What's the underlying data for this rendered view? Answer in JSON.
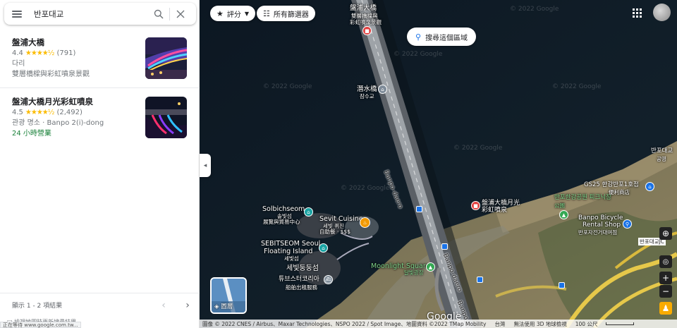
{
  "search": {
    "query": "반포대교"
  },
  "results": [
    {
      "title": "盤浦大橋",
      "rating": "4.4",
      "stars": "★★★★½",
      "reviews": "(791)",
      "line1": "다리",
      "line2": "雙層橋樑與彩虹噴泉景觀",
      "open": ""
    },
    {
      "title": "盤浦大橋月光彩虹噴泉",
      "rating": "4.5",
      "stars": "★★★★½",
      "reviews": "(2,492)",
      "line1": "관광 명소 · Banpo 2(i)-dong",
      "line2": "",
      "open": "24 小時營業"
    }
  ],
  "pager": {
    "text": "顯示 1 - 2 項結果"
  },
  "footer": {
    "text": "□ 檢視地圖時更新搜尋結果"
  },
  "status_url": "正在等待 www.google.com.tw...",
  "map": {
    "chips": {
      "rating": "評分",
      "filters": "所有篩選器"
    },
    "search_area": "搜尋這個區域",
    "layers_label": "圖層",
    "labels": {
      "bridge": "盤浦大橋",
      "bridge_sub": "雙層橋樑與",
      "bridge_sub2": "彩虹噴泉景觀",
      "jamsu": "潛水橋",
      "jamsu_kr": "잠수교",
      "banpo_daero_1": "Banpo-daero",
      "banpo_daero_2": "Banpo-daero",
      "banpo_daero_3": "Banpo-daero",
      "solbitseom": "Solbichseom",
      "solbitseom_kr": "솔빛섬",
      "solbitseom_sub": "展覽與貿易中心",
      "sevit_cuisine": "Sevit Cuisine",
      "sevit_cuisine_kr": "세빛 퀴진",
      "sevit_cuisine_sub": "自助餐 · $$$",
      "sebitseom": "SEBITSEOM Seoul",
      "floating": "Floating Island",
      "sebitseom_kr": "세빛섬",
      "sevit_dongdong": "세빛둥둥섬",
      "tube": "튜브스터코리아",
      "tube_sub": "船舶出租服務",
      "moonlight": "Moonlight Square",
      "moonlight_kr": "달빛광장",
      "fountain": "盤浦大橋月光",
      "fountain2": "彩虹噴泉",
      "banpo_park": "반포한강공원 피크닉장",
      "banpo_park2": "公園",
      "gs25": "GS25 한강반포1호점",
      "gs25_sub": "便利商店",
      "bicycle": "Banpo Bicycle",
      "bicycle2": "Rental Shop",
      "bicycle_kr": "반포자전거대여점",
      "banpo_jc": "반포대교JC",
      "banpo_edge": "반포대교",
      "banpo_edge2": "공영"
    },
    "watermark": "© 2022 Google",
    "google": "Google",
    "attribution": "圖像 © 2022 CNES / Airbus、Maxar Technologies、NSPO 2022 / Spot Image、地圖資料 ©2022 TMap Mobility",
    "country": "台灣",
    "no3d": "無法使用 3D 地球檢視",
    "scale": "100 公尺"
  }
}
